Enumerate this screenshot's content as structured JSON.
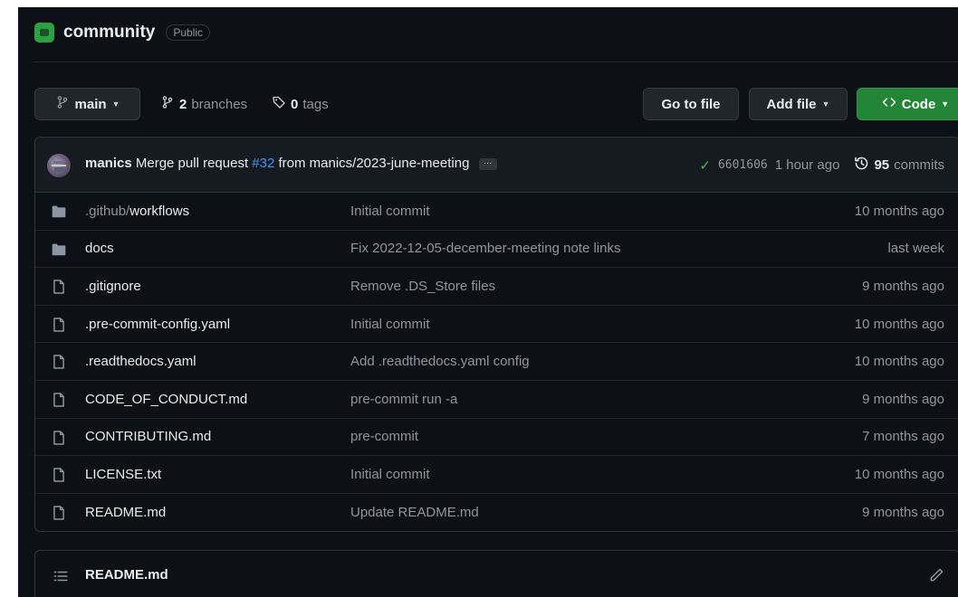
{
  "repo": {
    "name": "community",
    "visibility": "Public"
  },
  "toolbar": {
    "branch": "main",
    "branches_count": "2",
    "branches_label": "branches",
    "tags_count": "0",
    "tags_label": "tags",
    "go_to_file": "Go to file",
    "add_file": "Add file",
    "code": "Code"
  },
  "latest_commit": {
    "author": "manics",
    "message_prefix": "Merge pull request",
    "pr_link": "#32",
    "message_suffix": "from manics/2023-june-meeting",
    "ellipsis": "…",
    "sha": "6601606",
    "time": "1 hour ago",
    "commits_count": "95",
    "commits_label": "commits"
  },
  "files": [
    {
      "type": "folder",
      "name_prefix": ".github/",
      "name": "workflows",
      "message": "Initial commit",
      "age": "10 months ago"
    },
    {
      "type": "folder",
      "name_prefix": "",
      "name": "docs",
      "message": "Fix 2022-12-05-december-meeting note links",
      "age": "last week"
    },
    {
      "type": "file",
      "name_prefix": "",
      "name": ".gitignore",
      "message": "Remove .DS_Store files",
      "age": "9 months ago"
    },
    {
      "type": "file",
      "name_prefix": "",
      "name": ".pre-commit-config.yaml",
      "message": "Initial commit",
      "age": "10 months ago"
    },
    {
      "type": "file",
      "name_prefix": "",
      "name": ".readthedocs.yaml",
      "message": "Add .readthedocs.yaml config",
      "age": "10 months ago"
    },
    {
      "type": "file",
      "name_prefix": "",
      "name": "CODE_OF_CONDUCT.md",
      "message": "pre-commit run -a",
      "age": "9 months ago"
    },
    {
      "type": "file",
      "name_prefix": "",
      "name": "CONTRIBUTING.md",
      "message": "pre-commit",
      "age": "7 months ago"
    },
    {
      "type": "file",
      "name_prefix": "",
      "name": "LICENSE.txt",
      "message": "Initial commit",
      "age": "10 months ago"
    },
    {
      "type": "file",
      "name_prefix": "",
      "name": "README.md",
      "message": "Update README.md",
      "age": "9 months ago"
    }
  ],
  "readme": {
    "title": "README.md"
  },
  "colors": {
    "background": "#0d1117",
    "code_button": "#238636",
    "link": "#4493f8",
    "check": "#3fb950"
  },
  "icons": [
    "repo-icon",
    "branch-icon",
    "tag-icon",
    "code-icon",
    "history-icon",
    "folder-icon",
    "file-icon",
    "list-icon",
    "pencil-icon",
    "check-icon"
  ]
}
